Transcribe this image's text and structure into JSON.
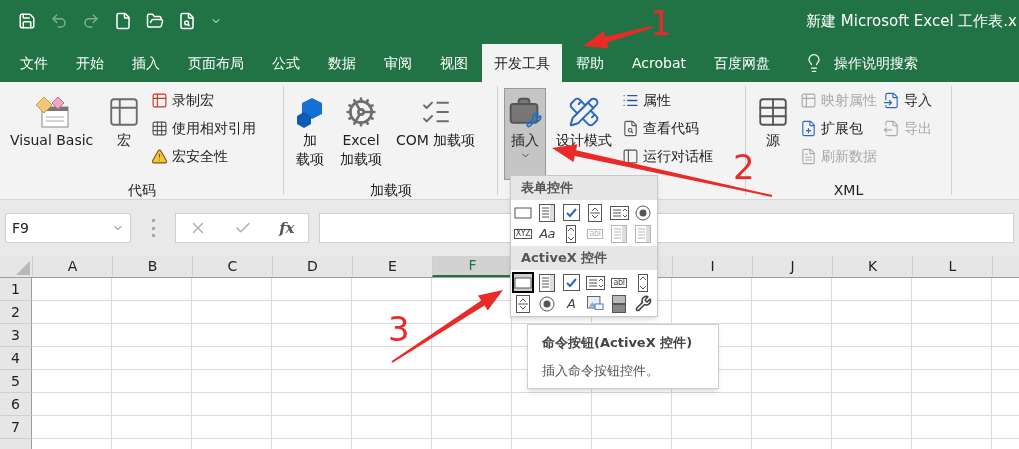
{
  "window": {
    "title": "新建 Microsoft Excel 工作表.x"
  },
  "tabs": [
    {
      "label": "文件",
      "kind": "tab",
      "selected": false
    },
    {
      "label": "开始",
      "kind": "tab",
      "selected": false
    },
    {
      "label": "插入",
      "kind": "tab",
      "selected": false
    },
    {
      "label": "页面布局",
      "kind": "tab",
      "selected": false
    },
    {
      "label": "公式",
      "kind": "tab",
      "selected": false
    },
    {
      "label": "数据",
      "kind": "tab",
      "selected": false
    },
    {
      "label": "审阅",
      "kind": "tab",
      "selected": false
    },
    {
      "label": "视图",
      "kind": "tab",
      "selected": false
    },
    {
      "label": "开发工具",
      "kind": "tab",
      "selected": true
    },
    {
      "label": "帮助",
      "kind": "tab",
      "selected": false
    },
    {
      "label": "Acrobat",
      "kind": "tab",
      "selected": false
    },
    {
      "label": "百度网盘",
      "kind": "tab",
      "selected": false
    },
    {
      "label": "操作说明搜索",
      "kind": "search",
      "selected": false
    }
  ],
  "ribbon": {
    "groups": [
      {
        "label": "代码",
        "large": [
          {
            "lines": [
              "Visual Basic"
            ],
            "pressed": false,
            "dropdown": false
          },
          {
            "lines": [
              "宏"
            ],
            "pressed": false,
            "dropdown": false
          }
        ],
        "small_columns": [
          [
            {
              "label": "录制宏",
              "disabled": false
            },
            {
              "label": "使用相对引用",
              "disabled": false
            },
            {
              "label": "宏安全性",
              "disabled": false
            }
          ]
        ]
      },
      {
        "label": "加载项",
        "large": [
          {
            "lines": [
              "加",
              "载项"
            ],
            "pressed": false,
            "dropdown": false
          },
          {
            "lines": [
              "Excel",
              "加载项"
            ],
            "pressed": false,
            "dropdown": false
          },
          {
            "lines": [
              "COM 加载项"
            ],
            "pressed": false,
            "dropdown": false
          }
        ]
      },
      {
        "large": [
          {
            "lines": [
              "插入"
            ],
            "pressed": true,
            "dropdown": true
          },
          {
            "lines": [
              "设计模式"
            ],
            "pressed": false,
            "dropdown": false
          }
        ],
        "small_columns": [
          [
            {
              "label": "属性",
              "disabled": false
            },
            {
              "label": "查看代码",
              "disabled": false
            },
            {
              "label": "运行对话框",
              "disabled": false
            }
          ]
        ]
      },
      {
        "label": "XML",
        "large": [
          {
            "lines": [
              "源"
            ],
            "pressed": false,
            "dropdown": false
          }
        ],
        "small_columns": [
          [
            {
              "label": "映射属性",
              "disabled": true
            },
            {
              "label": "扩展包",
              "disabled": false
            },
            {
              "label": "刷新数据",
              "disabled": true
            }
          ],
          [
            {
              "label": "导入",
              "disabled": false
            },
            {
              "label": "导出",
              "disabled": true
            }
          ]
        ]
      }
    ]
  },
  "formula_bar": {
    "name_box": "F9",
    "function_label": "fx"
  },
  "sheet": {
    "columns_left": [
      {
        "label": "A",
        "selected": false
      },
      {
        "label": "B",
        "selected": false
      },
      {
        "label": "C",
        "selected": false
      },
      {
        "label": "D",
        "selected": false
      },
      {
        "label": "E",
        "selected": false
      },
      {
        "label": "F",
        "selected": true
      }
    ],
    "columns_right": [
      {
        "label": "I",
        "selected": false
      },
      {
        "label": "J",
        "selected": false
      },
      {
        "label": "K",
        "selected": false
      },
      {
        "label": "L",
        "selected": false
      }
    ],
    "rows": [
      "1",
      "2",
      "3",
      "4",
      "5",
      "6",
      "7"
    ]
  },
  "insert_menu": {
    "sections": [
      {
        "title": "表单控件",
        "controls": [
          {
            "kind": "button",
            "selected": false,
            "disabled": false
          },
          {
            "kind": "listbox",
            "selected": false,
            "disabled": false
          },
          {
            "kind": "checkbox",
            "selected": false,
            "disabled": false
          },
          {
            "kind": "spinner",
            "selected": false,
            "disabled": false
          },
          {
            "kind": "combo",
            "selected": false,
            "disabled": false
          },
          {
            "kind": "radio",
            "selected": false,
            "disabled": false
          },
          {
            "kind": "glyph",
            "glyph": "XYZ",
            "selected": false,
            "disabled": false
          },
          {
            "kind": "glyph",
            "glyph": "Aa",
            "selected": false,
            "disabled": false
          },
          {
            "kind": "scrollbar",
            "selected": false,
            "disabled": false
          },
          {
            "kind": "glyph",
            "glyph": "abl",
            "selected": false,
            "disabled": true
          },
          {
            "kind": "listbox",
            "selected": false,
            "disabled": true
          },
          {
            "kind": "listbox",
            "selected": false,
            "disabled": true
          }
        ]
      },
      {
        "title": "ActiveX 控件",
        "controls": [
          {
            "kind": "button",
            "selected": true,
            "disabled": false
          },
          {
            "kind": "listbox",
            "selected": false,
            "disabled": false
          },
          {
            "kind": "checkbox",
            "selected": false,
            "disabled": false
          },
          {
            "kind": "combo",
            "selected": false,
            "disabled": false
          },
          {
            "kind": "glyph",
            "glyph": "abl",
            "selected": false,
            "disabled": false
          },
          {
            "kind": "scrollbar",
            "selected": false,
            "disabled": false
          },
          {
            "kind": "spinner",
            "selected": false,
            "disabled": false
          },
          {
            "kind": "radio",
            "selected": false,
            "disabled": false
          },
          {
            "kind": "glyph",
            "glyph": "A",
            "selected": false,
            "disabled": false
          },
          {
            "kind": "image",
            "selected": false,
            "disabled": false
          },
          {
            "kind": "toggle",
            "selected": false,
            "disabled": false
          },
          {
            "kind": "more",
            "selected": false,
            "disabled": false
          }
        ]
      }
    ]
  },
  "tooltip": {
    "title": "命令按钮(ActiveX 控件)",
    "description": "插入命令按钮控件。"
  },
  "annotations": [
    {
      "label": "1"
    },
    {
      "label": "2"
    },
    {
      "label": "3"
    }
  ]
}
